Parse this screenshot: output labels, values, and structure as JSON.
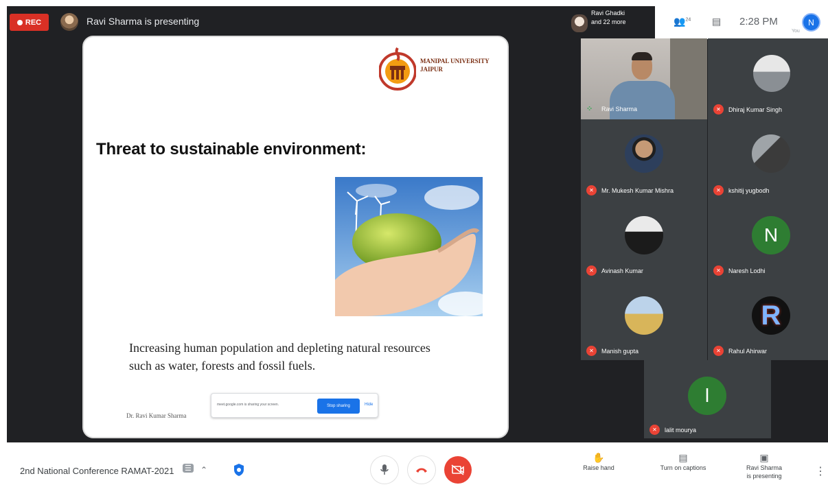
{
  "top_bar": {
    "rec_label": "REC",
    "presenting_text": "Ravi Sharma is presenting",
    "others_line1": "Ravi Ghadki",
    "others_line2": "and 22 more",
    "participants_count": "24",
    "time": "2:28 PM",
    "you_label": "You",
    "user_initial": "N"
  },
  "slide": {
    "university_line1": "MANIPAL UNIVERSITY",
    "university_line2": "JAIPUR",
    "title": "Threat to sustainable environment:",
    "body_line1": "Increasing human population and depleting natural resources",
    "body_line2": "such as water, forests and fossil fuels.",
    "footer": "Dr. Ravi Kumar Sharma"
  },
  "share_bar": {
    "text": "meet.google.com is sharing your screen.",
    "stop_label": "Stop sharing",
    "hide_label": "Hide"
  },
  "participants": [
    {
      "name": "Ravi Sharma"
    },
    {
      "name": "Dhiraj Kumar Singh"
    },
    {
      "name": "Mr. Mukesh Kumar Mishra"
    },
    {
      "name": "kshitij yugbodh"
    },
    {
      "name": "Avinash Kumar"
    },
    {
      "name": "Naresh Lodhi",
      "initial": "N",
      "color": "#2e7d32"
    },
    {
      "name": "Manish gupta"
    },
    {
      "name": "Rahul Ahirwar",
      "initial": "R"
    },
    {
      "name": "lalit mourya",
      "initial": "l",
      "color": "#2e7d32"
    }
  ],
  "controls": {
    "meeting_name": "2nd National Conference RAMAT-2021",
    "raise_hand": "Raise hand",
    "captions": "Turn on captions",
    "presenting_line1": "Ravi Sharma",
    "presenting_line2": "is presenting"
  },
  "colors": {
    "stage_bg": "#202124",
    "rec_red": "#d93025",
    "mute_red": "#ea4335",
    "accent_blue": "#1a73e8",
    "avatar_green": "#2e7d32"
  }
}
